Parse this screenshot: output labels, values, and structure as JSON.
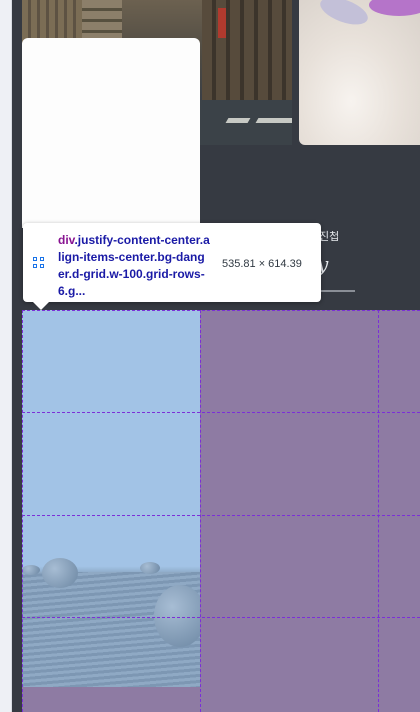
{
  "tooltip": {
    "selector_tag": "div",
    "selector_classes": ".justify-content-center.align-items-center.bg-danger.d-grid.w-100.grid-rows-6.g...",
    "size": "535.81 × 614.39",
    "icon": "grid-icon"
  },
  "page": {
    "korean_fragment": "진첩",
    "cursive_fragment": "y"
  },
  "colors": {
    "overlay_purple": "#8e7ba3",
    "overlay_blue": "#a2c3e6",
    "grid_line": "#7b2fd8",
    "dark_bg": "#363a42"
  }
}
